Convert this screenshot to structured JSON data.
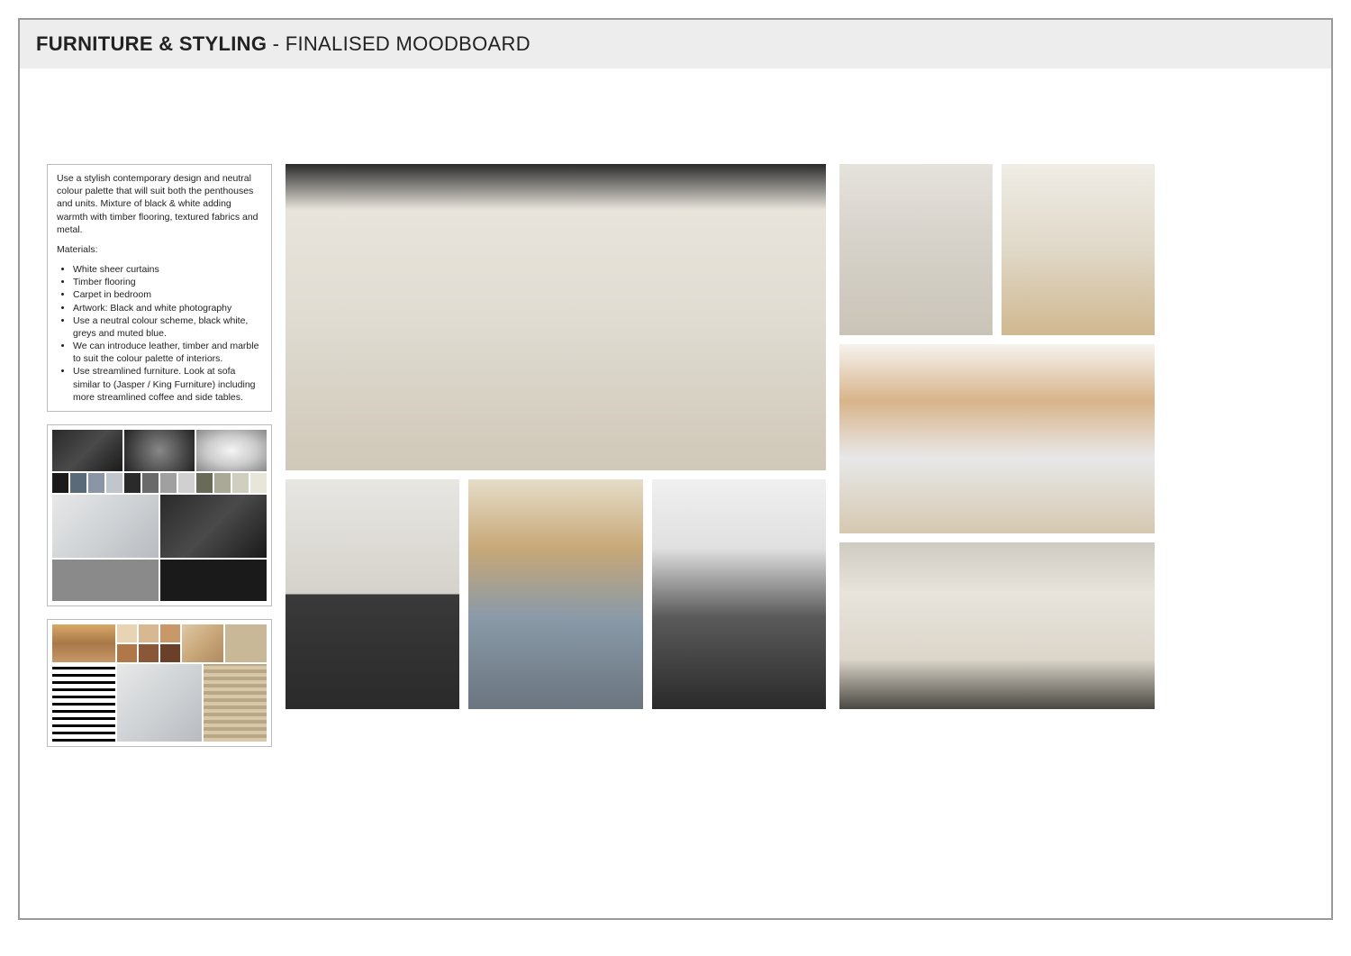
{
  "header": {
    "title_bold": "FURNITURE & STYLING",
    "title_sep": " - ",
    "title_light": "FINALISED MOODBOARD"
  },
  "description": {
    "intro": "Use a stylish contemporary design and neutral colour palette that will suit both the penthouses and units. Mixture of black & white adding warmth with timber flooring, textured fabrics and metal.",
    "materials_label": "Materials:",
    "materials": [
      "White sheer curtains",
      "Timber flooring",
      "Carpet in bedroom",
      "Artwork: Black and white photography",
      "Use a neutral colour scheme, black white, greys and muted blue.",
      "We can introduce leather, timber and marble to suit the colour palette of interiors.",
      "Use streamlined furniture.   Look at sofa similar to (Jasper / King Furniture)  including more streamlined coffee and side tables."
    ]
  },
  "palette1": {
    "row_images": [
      "dark-abstract",
      "water-ripple",
      "feather-bw"
    ],
    "swatches_row1": [
      "#1a1a1a",
      "#5a6a78",
      "#8a96a6",
      "#c0c6cc",
      "#2a2a2a",
      "#6a6a6a",
      "#a0a0a0",
      "#d0d0d0",
      "#6a6a58",
      "#aaa896",
      "#d0cebe",
      "#e8e6d8"
    ],
    "bottom_blocks": [
      {
        "name": "sofa-vignette",
        "class": "ph-cool"
      },
      {
        "name": "charcoal-weave",
        "class": "ph-dark"
      },
      {
        "name": "grey-weave",
        "color": "#8a8a8a"
      },
      {
        "name": "black-fabric",
        "color": "#1a1a1a"
      }
    ]
  },
  "palette2": {
    "top_left_image": "autumn-lake",
    "warm_swatches": [
      "#e8d4b4",
      "#d8b890",
      "#c89868",
      "#b07848",
      "#8a5838",
      "#6a4028"
    ],
    "textures": [
      "beige-linen",
      "tan-stone",
      "cream-weave"
    ],
    "bottom_images": [
      "geometric-bw",
      "bedroom-minimal",
      "stripe-weave"
    ]
  },
  "images": {
    "hero": "open-plan-marble-kitchen-living",
    "mid_row": [
      "bathroom-timber-vanity",
      "tan-leather-lounge",
      "monochrome-sofa-coffee-table"
    ],
    "right_top": [
      "reading-nook-floor-lamp",
      "white-kitchen-bar-stools"
    ],
    "right_mid": "timber-kitchen-marble-island",
    "right_bottom": "open-living-marble-kitchen-grey-sofa"
  }
}
